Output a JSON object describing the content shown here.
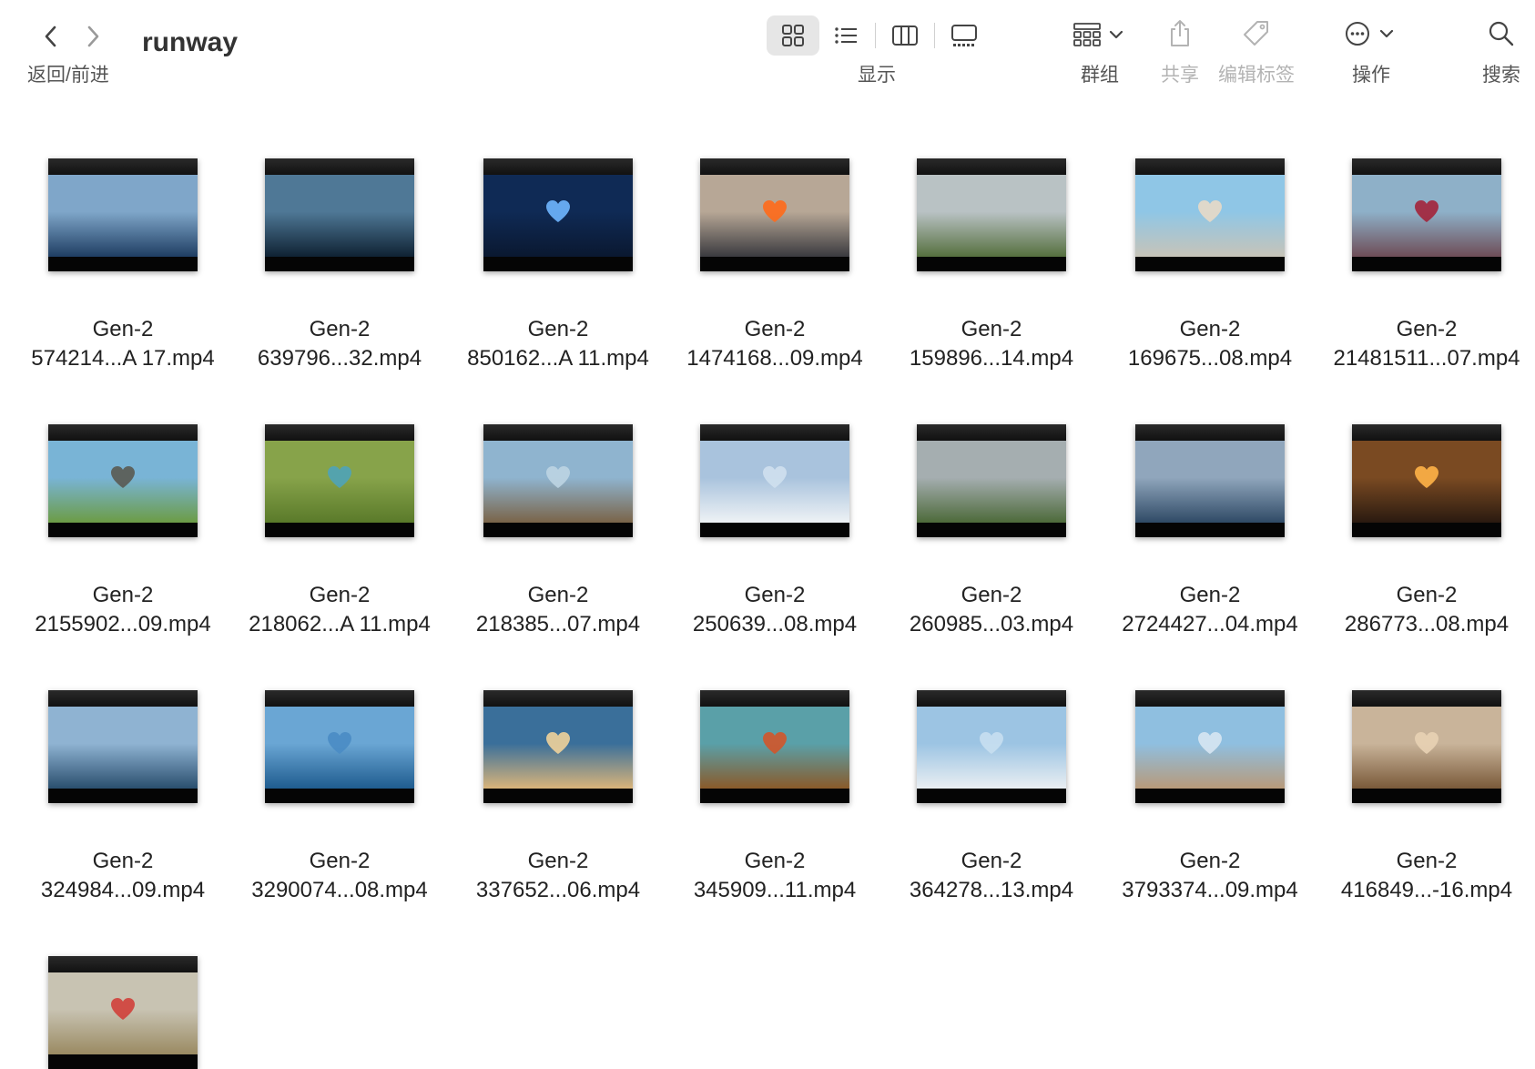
{
  "window": {
    "title": "runway"
  },
  "toolbar": {
    "nav_label": "返回/前进",
    "view_label": "显示",
    "group_label": "群组",
    "share_label": "共享",
    "tags_label": "编辑标签",
    "actions_label": "操作",
    "search_label": "搜索"
  },
  "icons": {
    "back": "chevron-left-icon",
    "forward": "chevron-right-icon",
    "icon_view": "grid-view-icon",
    "list_view": "list-view-icon",
    "column_view": "column-view-icon",
    "gallery_view": "gallery-view-icon",
    "group": "group-icon",
    "share": "share-icon",
    "tag": "tag-icon",
    "more": "ellipsis-circle-icon",
    "search": "search-icon"
  },
  "files": [
    {
      "line1": "Gen-2",
      "line2": "574214...A 17.mp4",
      "sky": "#7fa6c9",
      "ground": "#1f3e63",
      "heart": ""
    },
    {
      "line1": "Gen-2",
      "line2": "639796...32.mp4",
      "sky": "#4f7896",
      "ground": "#0f2233",
      "heart": ""
    },
    {
      "line1": "Gen-2",
      "line2": "850162...A 11.mp4",
      "sky": "#0f2a55",
      "ground": "#0a1830",
      "heart": "#6fb6ff"
    },
    {
      "line1": "Gen-2",
      "line2": "1474168...09.mp4",
      "sky": "#b7a796",
      "ground": "#3a3a3f",
      "heart": "#ff6a1a"
    },
    {
      "line1": "Gen-2",
      "line2": "159896...14.mp4",
      "sky": "#b9c2c4",
      "ground": "#56703f",
      "heart": ""
    },
    {
      "line1": "Gen-2",
      "line2": "169675...08.mp4",
      "sky": "#8fc6e6",
      "ground": "#c7c4b8",
      "heart": "#e8d9c6"
    },
    {
      "line1": "Gen-2",
      "line2": "21481511...07.mp4",
      "sky": "#8eb0c8",
      "ground": "#6e4d57",
      "heart": "#a3243a"
    },
    {
      "line1": "Gen-2",
      "line2": "2155902...09.mp4",
      "sky": "#79b4d6",
      "ground": "#6c9c45",
      "heart": "#5a5a52"
    },
    {
      "line1": "Gen-2",
      "line2": "218062...A 11.mp4",
      "sky": "#87a34a",
      "ground": "#5a7a2a",
      "heart": "#4fa3b8"
    },
    {
      "line1": "Gen-2",
      "line2": "218385...07.mp4",
      "sky": "#8fb4cf",
      "ground": "#7a6448",
      "heart": "#bcd4e2"
    },
    {
      "line1": "Gen-2",
      "line2": "250639...08.mp4",
      "sky": "#a9c3dd",
      "ground": "#eef2f5",
      "heart": "#cfe0ee"
    },
    {
      "line1": "Gen-2",
      "line2": "260985...03.mp4",
      "sky": "#a5aeb0",
      "ground": "#4d6a3a",
      "heart": ""
    },
    {
      "line1": "Gen-2",
      "line2": "2724427...04.mp4",
      "sky": "#90a6bc",
      "ground": "#2f4a66",
      "heart": ""
    },
    {
      "line1": "Gen-2",
      "line2": "286773...08.mp4",
      "sky": "#7a4a22",
      "ground": "#2a1a10",
      "heart": "#ffb347"
    },
    {
      "line1": "Gen-2",
      "line2": "324984...09.mp4",
      "sky": "#8fb3d2",
      "ground": "#2a4f6e",
      "heart": ""
    },
    {
      "line1": "Gen-2",
      "line2": "3290074...08.mp4",
      "sky": "#6aa6d4",
      "ground": "#1f5c8f",
      "heart": "#4a8cc4"
    },
    {
      "line1": "Gen-2",
      "line2": "337652...06.mp4",
      "sky": "#3a6f9a",
      "ground": "#d9b47a",
      "heart": "#f0d29a"
    },
    {
      "line1": "Gen-2",
      "line2": "345909...11.mp4",
      "sky": "#5aa0a8",
      "ground": "#8a5a2a",
      "heart": "#d2552a"
    },
    {
      "line1": "Gen-2",
      "line2": "364278...13.mp4",
      "sky": "#9cc4e3",
      "ground": "#e9eef2",
      "heart": "#c8dff0"
    },
    {
      "line1": "Gen-2",
      "line2": "3793374...09.mp4",
      "sky": "#8fbfe0",
      "ground": "#b89a7a",
      "heart": "#d7e6f2"
    },
    {
      "line1": "Gen-2",
      "line2": "416849...-16.mp4",
      "sky": "#c9b49a",
      "ground": "#7a5a3a",
      "heart": "#e8d2b4"
    },
    {
      "line1": "",
      "line2": "",
      "sky": "#c8c3b2",
      "ground": "#9a8a62",
      "heart": "#d0403a"
    }
  ]
}
